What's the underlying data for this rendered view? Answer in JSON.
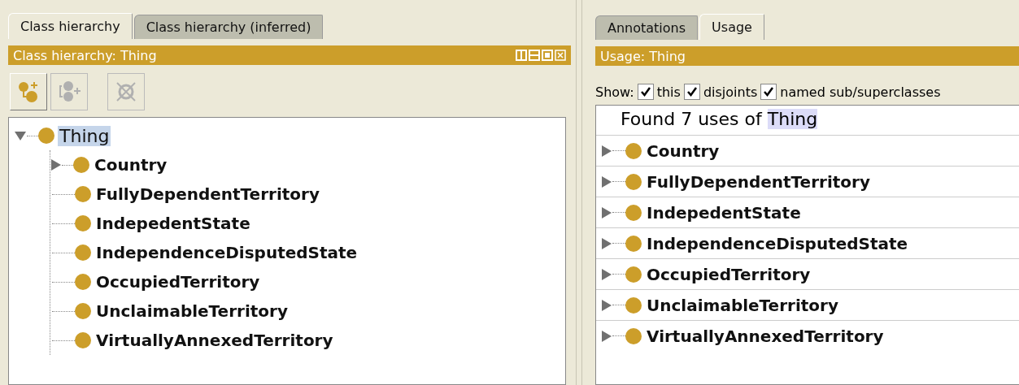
{
  "left_panel": {
    "tabs": [
      {
        "label": "Class hierarchy",
        "selected": true
      },
      {
        "label": "Class hierarchy (inferred)",
        "selected": false
      }
    ],
    "header": {
      "title": "Class hierarchy: Thing"
    },
    "toolbar": [
      {
        "kind": "add-subclass",
        "disabled": false
      },
      {
        "kind": "add-sibling",
        "disabled": true
      },
      {
        "kind": "delete",
        "disabled": true
      }
    ],
    "tree": [
      {
        "label": "Thing",
        "selected": true,
        "expanded": true,
        "children": [
          {
            "label": "Country",
            "selected": false,
            "expandable": true
          },
          {
            "label": "FullyDependentTerritory",
            "selected": false,
            "expandable": false
          },
          {
            "label": "IndepedentState",
            "selected": false,
            "expandable": false
          },
          {
            "label": "IndependenceDisputedState",
            "selected": false,
            "expandable": false
          },
          {
            "label": "OccupiedTerritory",
            "selected": false,
            "expandable": false
          },
          {
            "label": "UnclaimableTerritory",
            "selected": false,
            "expandable": false
          },
          {
            "label": "VirtuallyAnnexedTerritory",
            "selected": false,
            "expandable": false
          }
        ]
      }
    ]
  },
  "right_panel": {
    "tabs": [
      {
        "label": "Annotations",
        "selected": false
      },
      {
        "label": "Usage",
        "selected": true
      }
    ],
    "header": {
      "title": "Usage: Thing"
    },
    "show_label": "Show:",
    "show_options": [
      {
        "label": "this",
        "checked": true
      },
      {
        "label": "disjoints",
        "checked": true
      },
      {
        "label": "named sub/superclasses",
        "checked": true
      }
    ],
    "result": {
      "prefix": "Found 7 uses of",
      "entity": "Thing"
    },
    "usages": [
      {
        "label": "Country",
        "expanded": false
      },
      {
        "label": "FullyDependentTerritory",
        "expanded": false
      },
      {
        "label": "IndepedentState",
        "expanded": false
      },
      {
        "label": "IndependenceDisputedState",
        "expanded": false
      },
      {
        "label": "OccupiedTerritory",
        "expanded": false
      },
      {
        "label": "UnclaimableTerritory",
        "expanded": false
      },
      {
        "label": "VirtuallyAnnexedTerritory",
        "expanded": false
      }
    ]
  }
}
